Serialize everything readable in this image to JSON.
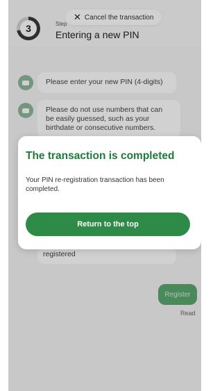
{
  "header": {
    "cancel_label": "Cancel the transaction",
    "step_number": "3",
    "step_label": "Step",
    "title": "Entering a new PIN"
  },
  "chat": {
    "messages": [
      {
        "text": "Please enter your new PIN (4-digits)"
      },
      {
        "text": "Please do not use numbers that can be easily guessed, such as your birthdate or consecutive numbers."
      }
    ],
    "partial_text": "registered",
    "user_reply": "Register",
    "read_status": "Read"
  },
  "dialog": {
    "title": "The transaction is completed",
    "body": "Your PIN re-registration transaction has been completed.",
    "button_label": "Return to the top"
  },
  "colors": {
    "accent": "#2e8b47",
    "title_green": "#1f7a3a",
    "bot_avatar": "#8fb79a",
    "user_bubble": "#5aa86e"
  }
}
